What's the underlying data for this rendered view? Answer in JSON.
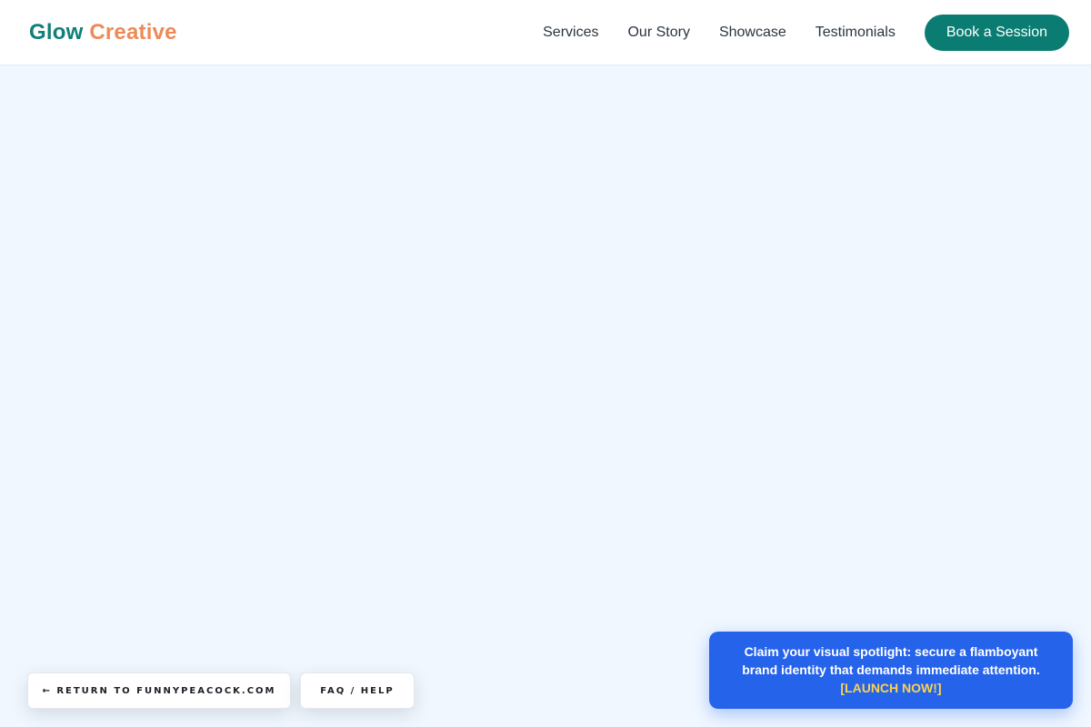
{
  "header": {
    "logo_part1": "Glow",
    "logo_part2": "Creative",
    "nav": [
      "Services",
      "Our Story",
      "Showcase",
      "Testimonials"
    ],
    "cta_label": "Book a Session"
  },
  "footer": {
    "return_label": "← RETURN TO FUNNYPEACOCK.COM",
    "faq_label": "FAQ / HELP"
  },
  "promo": {
    "text": "Claim your visual spotlight: secure a flamboyant brand identity that demands immediate attention.",
    "cta": "[LAUNCH NOW!]"
  },
  "colors": {
    "brand_primary": "#0a7c72",
    "brand_accent": "#ee8a55",
    "page_background": "#f0f7ff",
    "promo_background": "#2563eb",
    "promo_cta": "#fcd34d"
  }
}
